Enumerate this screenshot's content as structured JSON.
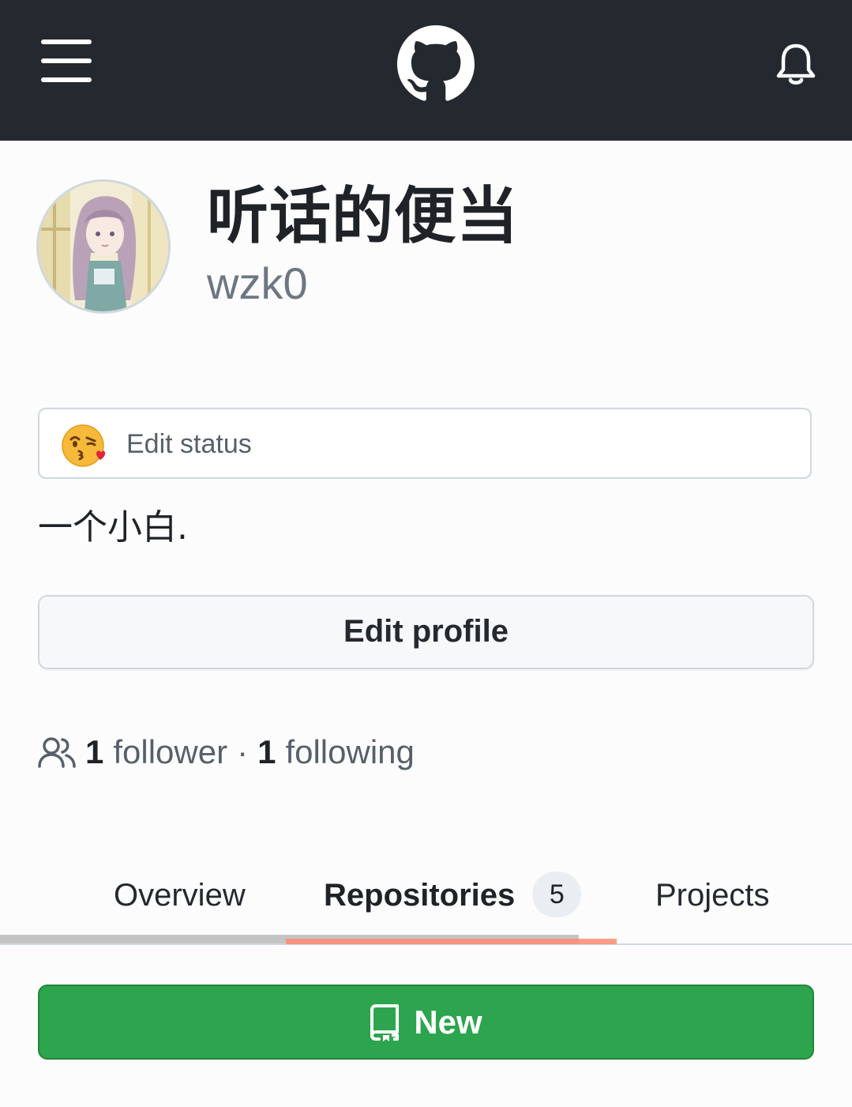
{
  "header": {
    "menu_icon": "hamburger-icon",
    "logo_icon": "github-logo-icon",
    "notifications_icon": "bell-icon"
  },
  "profile": {
    "display_name": "听话的便当",
    "username": "wzk0",
    "status_emoji": "face-blowing-kiss",
    "status_label": "Edit status",
    "bio": "一个小白.",
    "edit_profile_label": "Edit profile"
  },
  "social": {
    "followers_count": "1",
    "followers_label": "follower",
    "separator": "·",
    "following_count": "1",
    "following_label": "following"
  },
  "tabs": [
    {
      "label": "Overview"
    },
    {
      "label": "Repositories",
      "counter": "5",
      "active": true
    },
    {
      "label": "Projects"
    }
  ],
  "actions": {
    "new_label": "New"
  },
  "colors": {
    "header_bg": "#24292f",
    "accent_green": "#2da44e",
    "tab_underline": "#fd8c73"
  }
}
